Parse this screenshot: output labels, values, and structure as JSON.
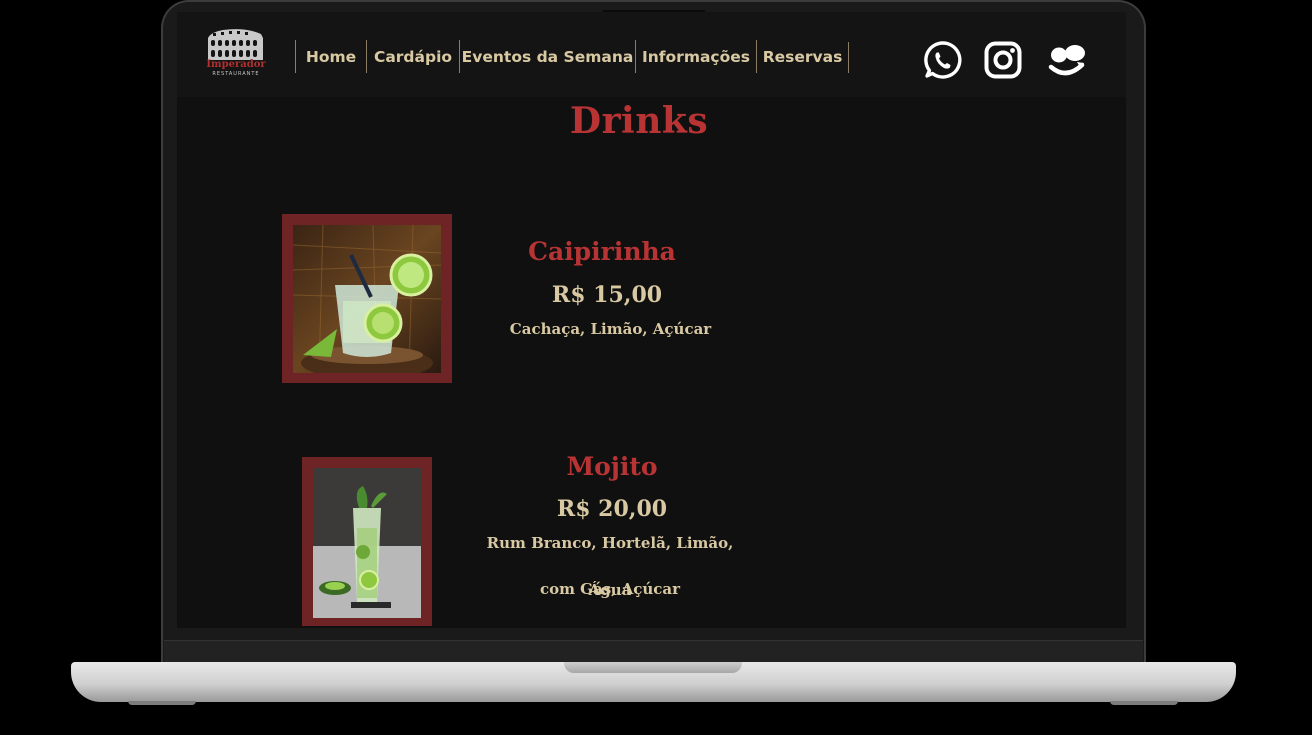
{
  "nav": {
    "items": [
      "Home",
      "Cardápio",
      "Eventos da Semana",
      "Informações",
      "Reservas"
    ]
  },
  "logo": {
    "name": "Imperador",
    "subtitle": "RESTAURANTE"
  },
  "social": {
    "icons": [
      "whatsapp-icon",
      "instagram-icon",
      "ifood-icon"
    ]
  },
  "menu": {
    "section_title": "Drinks",
    "items": [
      {
        "name": "Caipirinha",
        "price": "R$ 15,00",
        "description": [
          "Cachaça, Limão, Açúcar"
        ]
      },
      {
        "name": "Mojito",
        "price": "R$ 20,00",
        "description": [
          "Rum Branco, Hortelã, Limão, Água",
          "com Gás, Açúcar"
        ]
      }
    ]
  },
  "colors": {
    "accent_red": "#b83434",
    "gold_text": "#d9c9a3",
    "frame": "#6e2424",
    "background": "#101010"
  }
}
